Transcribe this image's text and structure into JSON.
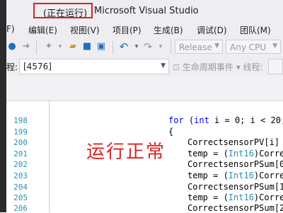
{
  "titlebar": {
    "running": "(正在运行)",
    "app": "Microsoft Visual Studio"
  },
  "menu": [
    "F)",
    "编辑(E)",
    "视图(V)",
    "项目(P)",
    "生成(B)",
    "调试(D)",
    "团队(M)"
  ],
  "toolbar": {
    "config": "Release",
    "platform": "Any CPU",
    "icons": [
      "forward-icon",
      "new-project-icon",
      "open-folder-icon",
      "save-icon",
      "save-all-icon",
      "undo-icon",
      "redo-icon"
    ]
  },
  "debug": {
    "process_label": "程:",
    "process_value": "[4576]",
    "lifecycle": "生命周期事件 ▾ 线程:"
  },
  "editor": {
    "lines": [
      {
        "num": "198",
        "code": "for (int i = 0; i < 20;"
      },
      {
        "num": "199",
        "code": "{"
      },
      {
        "num": "200",
        "code": "CorrectsensorPV[i] ="
      },
      {
        "num": "201",
        "code": "temp = (Int16)Corre"
      },
      {
        "num": "202",
        "code": "CorrectsensorPSum[0"
      },
      {
        "num": "203",
        "code": "temp = (Int16)Corre"
      },
      {
        "num": "204",
        "code": "CorrectsensorPSum[1"
      },
      {
        "num": "205",
        "code": "temp = (Int16)Corre"
      },
      {
        "num": "206",
        "code": "CorrectsensorPSum[2"
      }
    ]
  },
  "overlay": "运行正常",
  "colors": {
    "annotation_red": "#e02020",
    "keyword_blue": "#0000ff",
    "type_teal": "#2b91af"
  }
}
